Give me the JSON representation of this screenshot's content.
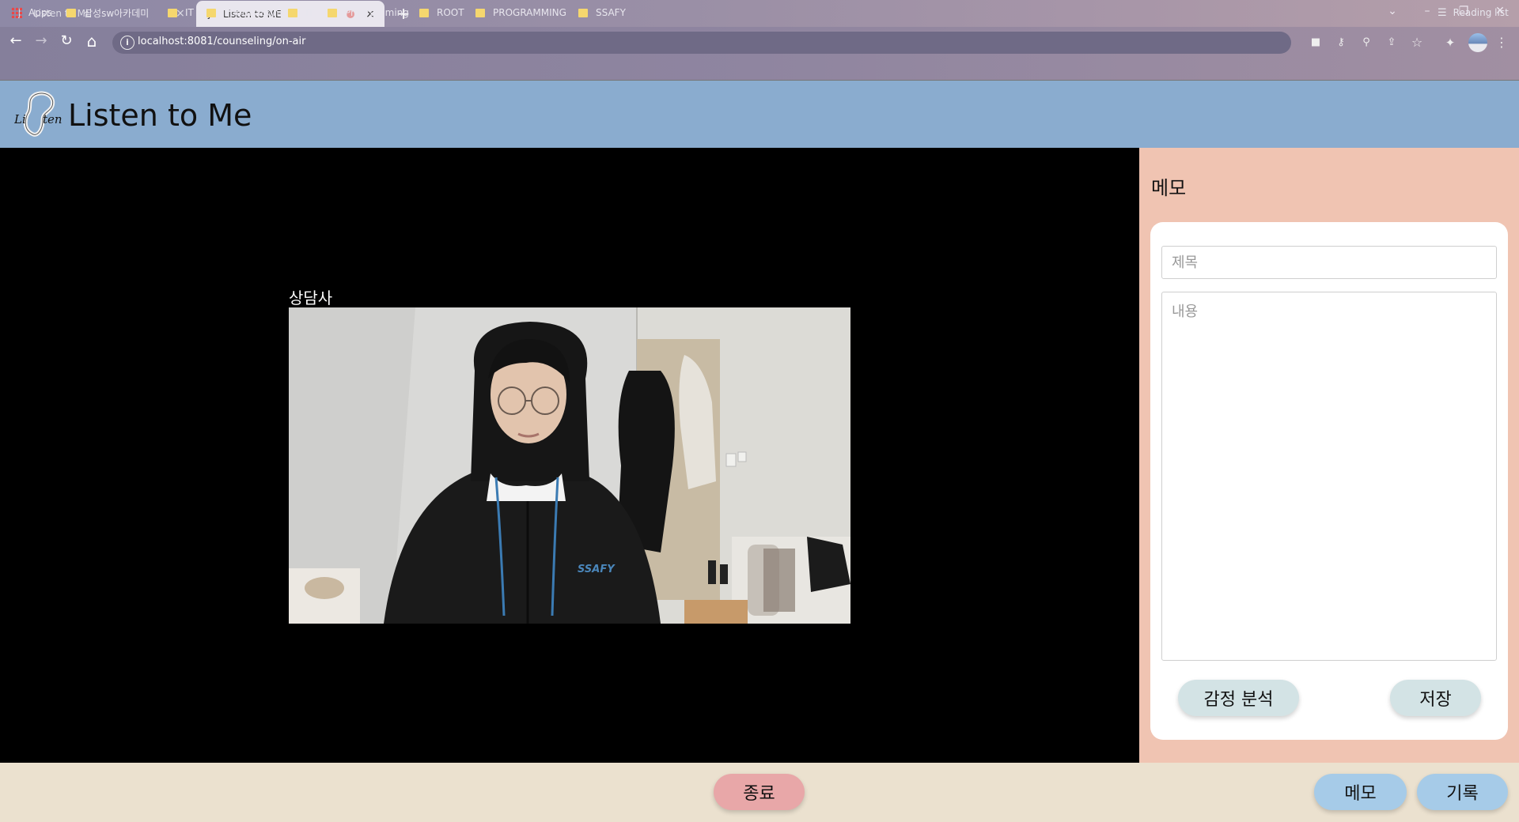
{
  "browser": {
    "tabs": [
      {
        "title": "Listen to ME",
        "active": false
      },
      {
        "title": "Listen to ME",
        "active": true
      }
    ],
    "new_tab": "+",
    "url": "localhost:8081/counseling/on-air",
    "bookmarks": [
      "Apps",
      "삼성sw아카데미",
      "IT",
      "Information",
      "IT",
      "Programming",
      "ROOT",
      "PROGRAMMING",
      "SSAFY"
    ],
    "reading_list": "Reading list",
    "icons": {
      "back": "←",
      "forward": "→",
      "reload": "↻",
      "home": "⌂",
      "info": "i",
      "close": "×",
      "minimize": "–",
      "restore": "❐",
      "window_close": "✕",
      "tab_search": "⌄",
      "camera": "■",
      "key": "⚷",
      "zoom": "⚲",
      "share": "⇪",
      "star": "☆",
      "extensions": "✦",
      "menu": "⋮",
      "reading": "☰"
    }
  },
  "app": {
    "logo_text": "Li  ten",
    "title": "Listen to Me",
    "brand_color": "#8aaccf"
  },
  "video": {
    "label": "상담사"
  },
  "memo": {
    "heading": "메모",
    "title_placeholder": "제목",
    "body_placeholder": "내용",
    "analyze_label": "감정 분석",
    "save_label": "저장"
  },
  "footer": {
    "end_label": "종료",
    "memo_label": "메모",
    "log_label": "기록"
  }
}
